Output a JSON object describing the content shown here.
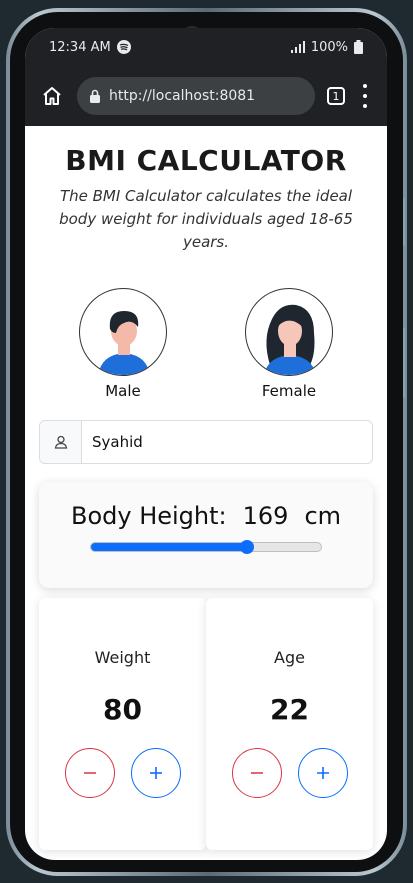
{
  "status": {
    "time": "12:34 AM",
    "battery": "100%"
  },
  "browser": {
    "url": "http://localhost:8081",
    "tab_count": "1"
  },
  "page": {
    "title": "BMI CALCULATOR",
    "subtitle": "The BMI Calculator calculates the ideal body weight for individuals aged 18-65 years."
  },
  "genders": [
    {
      "label": "Male"
    },
    {
      "label": "Female"
    }
  ],
  "name_input": {
    "value": "Syahid"
  },
  "height": {
    "label": "Body Height:",
    "value": "169",
    "unit": "cm",
    "slider_fraction": 0.68
  },
  "weight": {
    "label": "Weight",
    "value": "80"
  },
  "age": {
    "label": "Age",
    "value": "22"
  },
  "icons": {
    "home": "home-icon",
    "lock": "lock-icon",
    "tabs": "tabs-icon",
    "menu": "menu-icon",
    "user": "user-icon",
    "spotify": "spotify-icon",
    "signal": "signal-icon",
    "battery": "battery-icon"
  },
  "colors": {
    "accent": "#0d6efd",
    "danger": "#dc3545",
    "browser_chrome": "#202124"
  }
}
